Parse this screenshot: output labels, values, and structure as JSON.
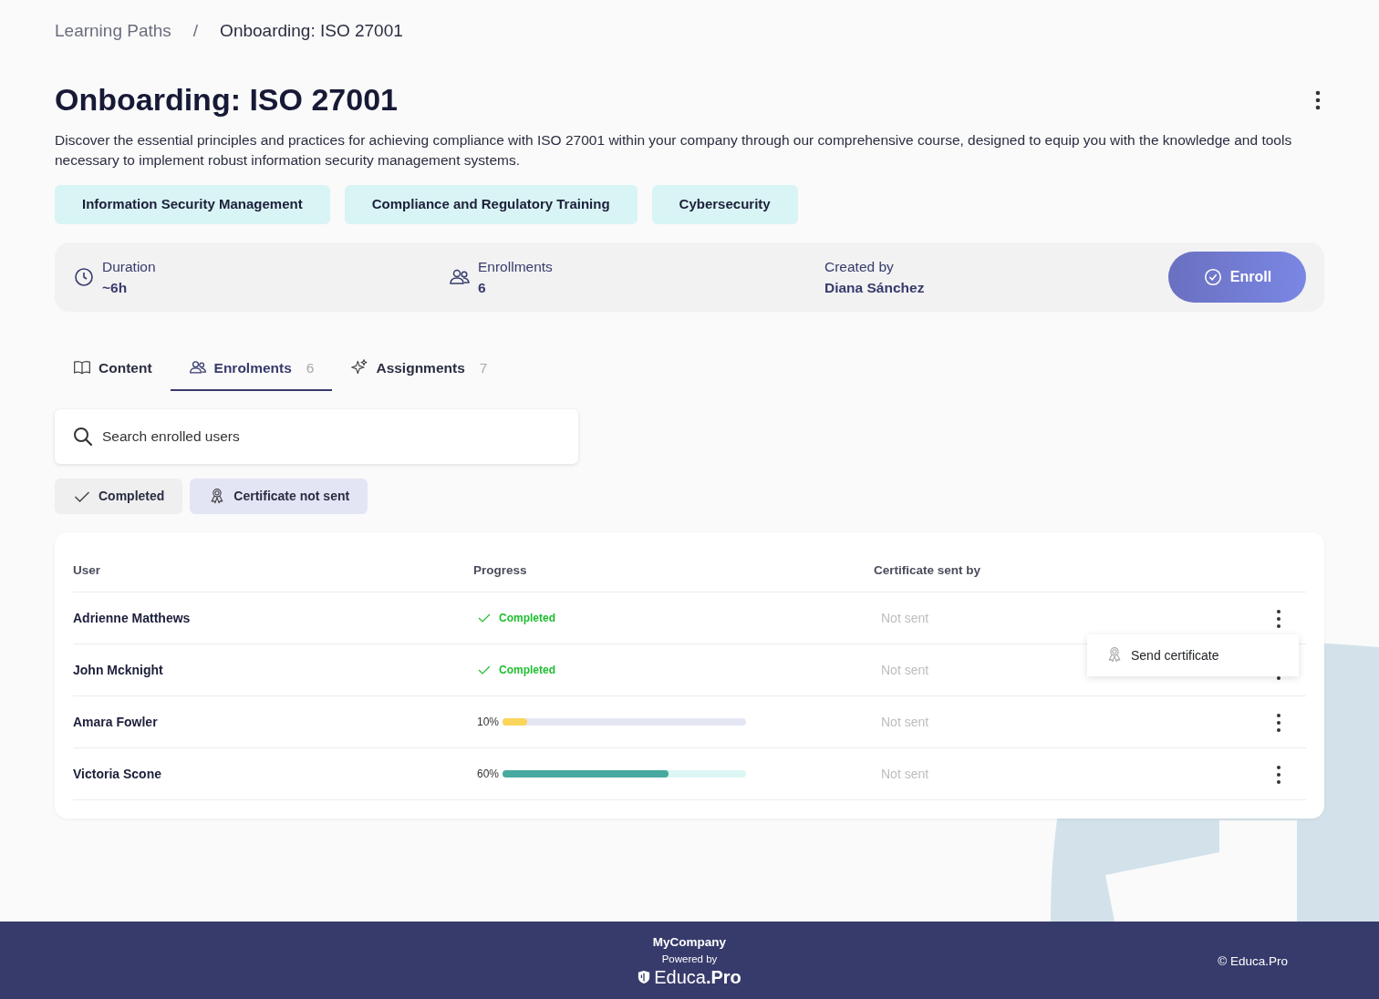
{
  "breadcrumb": [
    {
      "label": "Learning Paths",
      "current": false
    },
    {
      "label": "Onboarding: ISO 27001",
      "current": true
    }
  ],
  "breadcrumb_separator": "/",
  "title": "Onboarding: ISO 27001",
  "description": "Discover the essential principles and practices for achieving compliance with ISO 27001 within your company through our comprehensive course, designed to equip you with the knowledge and tools necessary to implement robust information security management systems.",
  "tags": [
    "Information Security Management",
    "Compliance and Regulatory Training",
    "Cybersecurity"
  ],
  "stats": [
    {
      "kind": "duration",
      "label": "Duration",
      "value": "~6h"
    },
    {
      "kind": "enrollments",
      "label": "Enrollments",
      "value": "6"
    },
    {
      "kind": "creator",
      "label": "Created by",
      "value": "Diana Sánchez"
    }
  ],
  "enroll_button": "Enroll",
  "tabs": [
    {
      "kind": "content",
      "label": "Content",
      "selected": false
    },
    {
      "kind": "enrolments",
      "label": "Enrolments",
      "count": "6",
      "selected": true
    },
    {
      "kind": "assignments",
      "label": "Assignments",
      "count": "7",
      "selected": false
    }
  ],
  "search": {
    "placeholder": "Search enrolled users"
  },
  "filters": [
    {
      "kind": "completed",
      "label": "Completed",
      "selected": false
    },
    {
      "kind": "certificate",
      "label": "Certificate not sent",
      "selected": true
    }
  ],
  "table": {
    "columns": [
      "User",
      "Progress",
      "Certificate sent by"
    ],
    "rows": [
      {
        "user": "Adrienne Matthews",
        "progress": {
          "kind": "completed",
          "label": "Completed"
        },
        "certificate": "Not sent"
      },
      {
        "user": "John Mcknight",
        "progress": {
          "kind": "completed",
          "label": "Completed"
        },
        "certificate": "Not sent"
      },
      {
        "user": "Amara Fowler",
        "progress": {
          "kind": "bar",
          "reading": "10%",
          "level": 0.1,
          "color": "#f9d55b"
        },
        "certificate": "Not sent"
      },
      {
        "user": "Victoria Scone",
        "progress": {
          "kind": "bar",
          "reading": "60%",
          "level": 0.68,
          "color": "#47a9a0"
        },
        "certificate": "Not sent"
      }
    ]
  },
  "row_menu": {
    "items": [
      "Send certificate"
    ]
  },
  "footer": {
    "company": "MyCompany",
    "powered_by": "Powered by",
    "brand": "Educa**.Pro**",
    "copyright": "© Educa.Pro"
  }
}
